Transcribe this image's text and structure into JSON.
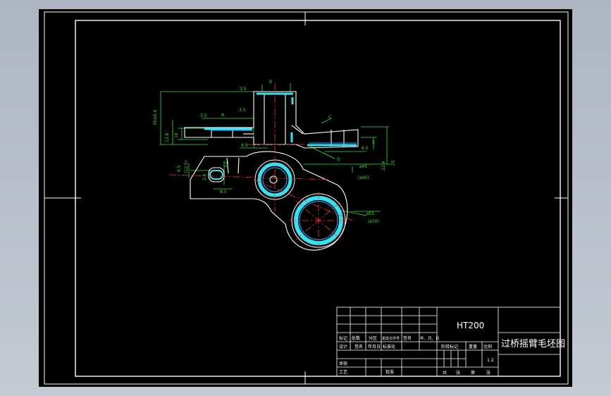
{
  "drawing": {
    "title_block": {
      "material": "HT200",
      "part_name": "过桥摇臂毛坯图",
      "scale_label": "比例",
      "scale_value": "1:2",
      "stage_mark_label": "阶段标记",
      "weight_label": "重量",
      "sheet_total_label": "共",
      "sheet_unit_label": "张",
      "sheet_no_label": "第",
      "sheet_no_unit": "张",
      "rev_headers": [
        "标记",
        "处数",
        "分区",
        "更改文件号",
        "签名",
        "年、月、日"
      ],
      "design_row": [
        "设计",
        "签名",
        "年月日",
        "标准化"
      ],
      "review_label": "审核",
      "process_label": "工艺",
      "approve_label": "批准"
    },
    "dimensions": {
      "d_left_height": "35±0.4",
      "d_left_inner": "12.8",
      "d_step": "3.5",
      "d_step2": "3.5",
      "d_left_h2": "16",
      "d_thick": "4.5",
      "d_top_rib": "3.5",
      "d_right_h": "5",
      "d_right_small": "6.5",
      "d_right_tol": "22.4",
      "d_right_big": "25",
      "d_ang_small": "2.6",
      "d_slot": "3.5",
      "d_slot_w": "8.5",
      "d_hub_dia": "ø41",
      "d_hub_ref": "(ø45)",
      "d_big_dia": "ø51",
      "d_big_ref": "(ø70)",
      "d_left_ref": "(12.5)",
      "d_left_tol": "6.5",
      "section_A": "A",
      "section_B": "B",
      "section_C": "C",
      "section_D": "D"
    }
  }
}
